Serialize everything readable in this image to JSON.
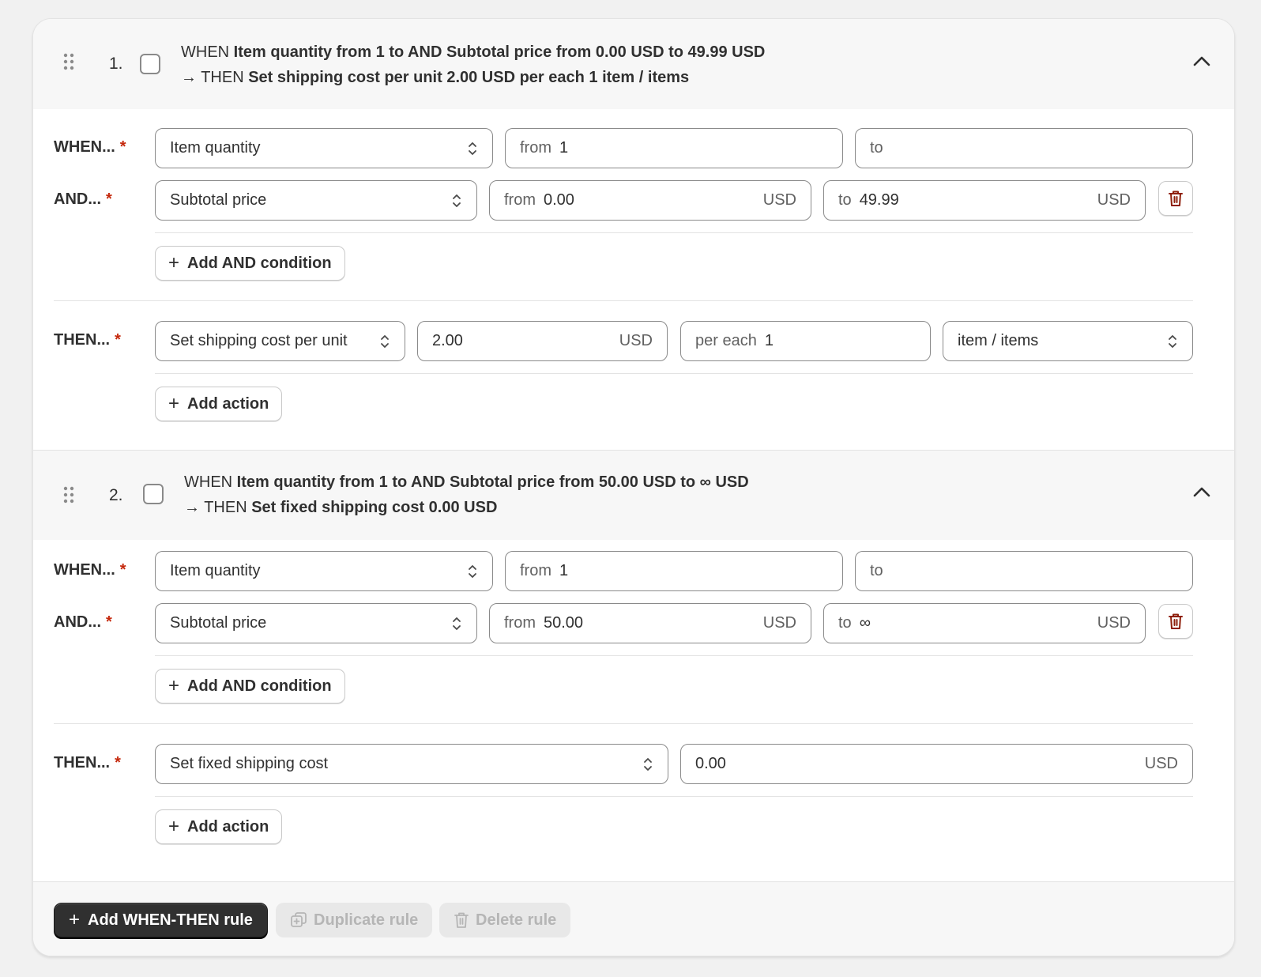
{
  "rules": [
    {
      "number": "1.",
      "summary_when_prefix": "WHEN",
      "summary_when": "Item quantity from 1 to AND Subtotal price from 0.00 USD to 49.99 USD",
      "summary_then_prefix": "→ THEN",
      "summary_then": "Set shipping cost per unit 2.00 USD per each 1 item / items",
      "when_label": "WHEN...",
      "and_label": "AND...",
      "then_label": "THEN...",
      "required_mark": "*",
      "condition1": {
        "type": "Item quantity",
        "from_prefix": "from",
        "from_value": "1",
        "to_prefix": "to",
        "to_value": ""
      },
      "condition2": {
        "type": "Subtotal price",
        "from_prefix": "from",
        "from_value": "0.00",
        "from_suffix": "USD",
        "to_prefix": "to",
        "to_value": "49.99",
        "to_suffix": "USD"
      },
      "add_and_condition": "Add AND condition",
      "action": {
        "type": "Set shipping cost per unit",
        "amount": "2.00",
        "amount_suffix": "USD",
        "per_prefix": "per each",
        "per_value": "1",
        "unit": "item / items"
      },
      "add_action": "Add action"
    },
    {
      "number": "2.",
      "summary_when_prefix": "WHEN",
      "summary_when": "Item quantity from 1 to AND Subtotal price from 50.00 USD to ∞ USD",
      "summary_then_prefix": "→ THEN",
      "summary_then": "Set fixed shipping cost 0.00 USD",
      "when_label": "WHEN...",
      "and_label": "AND...",
      "then_label": "THEN...",
      "required_mark": "*",
      "condition1": {
        "type": "Item quantity",
        "from_prefix": "from",
        "from_value": "1",
        "to_prefix": "to",
        "to_value": ""
      },
      "condition2": {
        "type": "Subtotal price",
        "from_prefix": "from",
        "from_value": "50.00",
        "from_suffix": "USD",
        "to_prefix": "to",
        "to_value": "∞",
        "to_suffix": "USD"
      },
      "add_and_condition": "Add AND condition",
      "action": {
        "type": "Set fixed shipping cost",
        "amount": "0.00",
        "amount_suffix": "USD"
      },
      "add_action": "Add action"
    }
  ],
  "footer": {
    "add_rule": "Add WHEN-THEN rule",
    "duplicate_rule": "Duplicate rule",
    "delete_rule": "Delete rule"
  },
  "icons": {
    "plus": "+",
    "drag": "drag-handle-icon",
    "chevron": "chevron-up-icon",
    "selector": "select-updown-icon",
    "trash": "trash-icon",
    "duplicate": "duplicate-icon"
  },
  "colors": {
    "required": "#c5280c",
    "trash": "#8e1f0b",
    "primary_button": "#303030",
    "header_bg": "#f7f7f7"
  }
}
